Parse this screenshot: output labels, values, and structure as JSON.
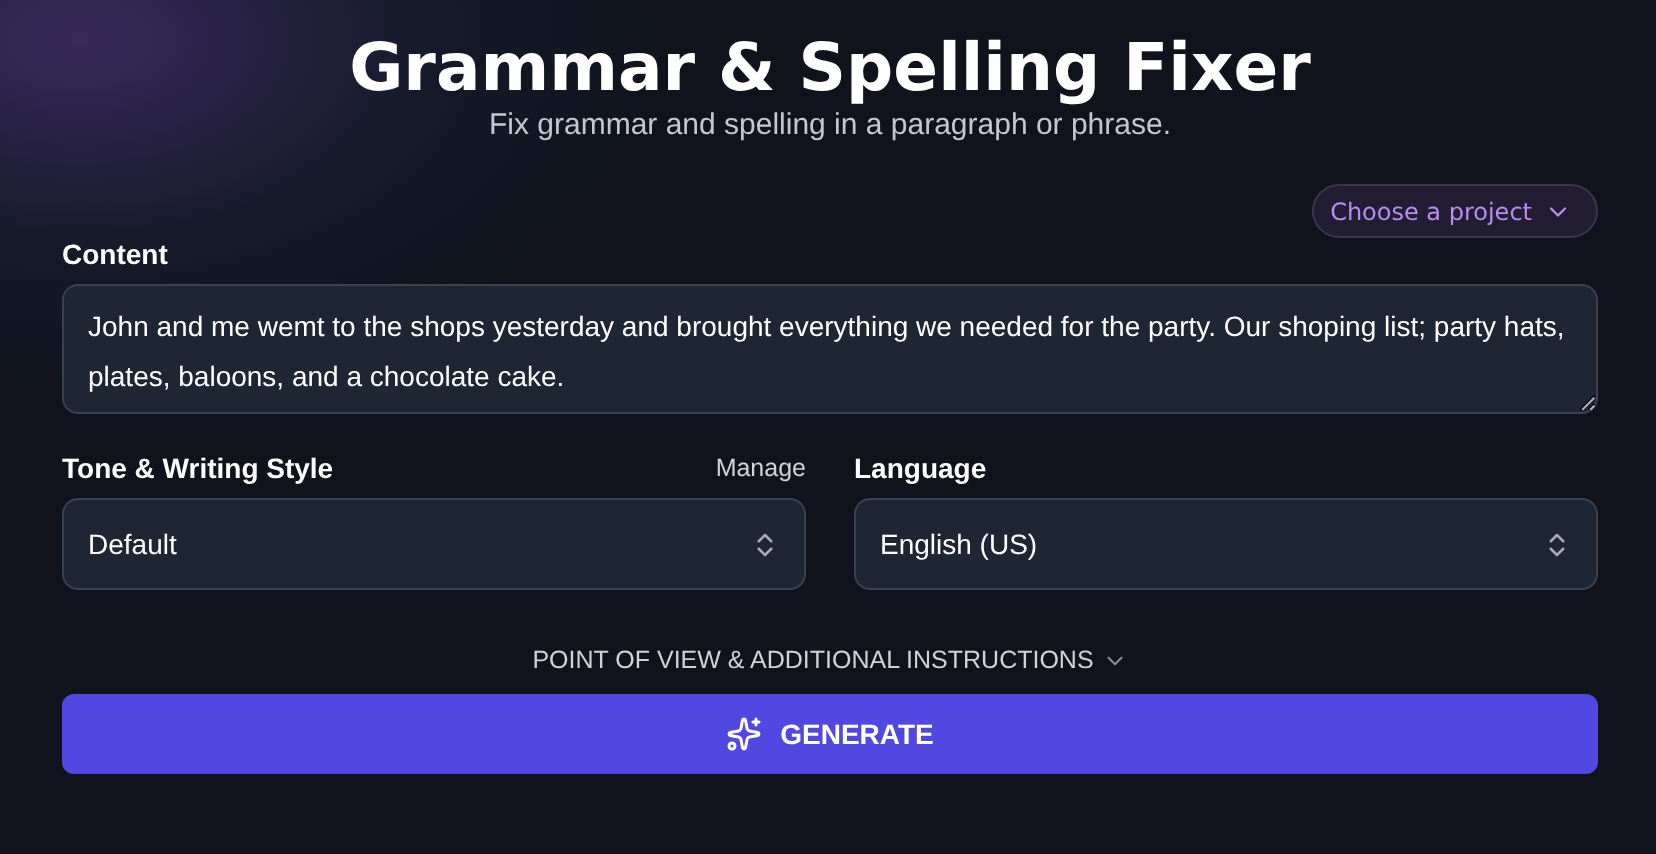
{
  "header": {
    "title": "Grammar & Spelling Fixer",
    "subtitle": "Fix grammar and spelling in a paragraph or phrase."
  },
  "project_picker": {
    "label": "Choose a project"
  },
  "content": {
    "label": "Content",
    "value": "John and me wemt to the shops yesterday and brought everything we needed for the party. Our shoping list; party hats, plates, baloons, and a chocolate cake."
  },
  "tone": {
    "label": "Tone & Writing Style",
    "link": "Manage",
    "value": "Default"
  },
  "language": {
    "label": "Language",
    "value": "English (US)"
  },
  "options_toggle": {
    "label": "POINT OF VIEW & ADDITIONAL INSTRUCTIONS",
    "expanded": false
  },
  "generate_button": {
    "label": "GENERATE"
  }
}
